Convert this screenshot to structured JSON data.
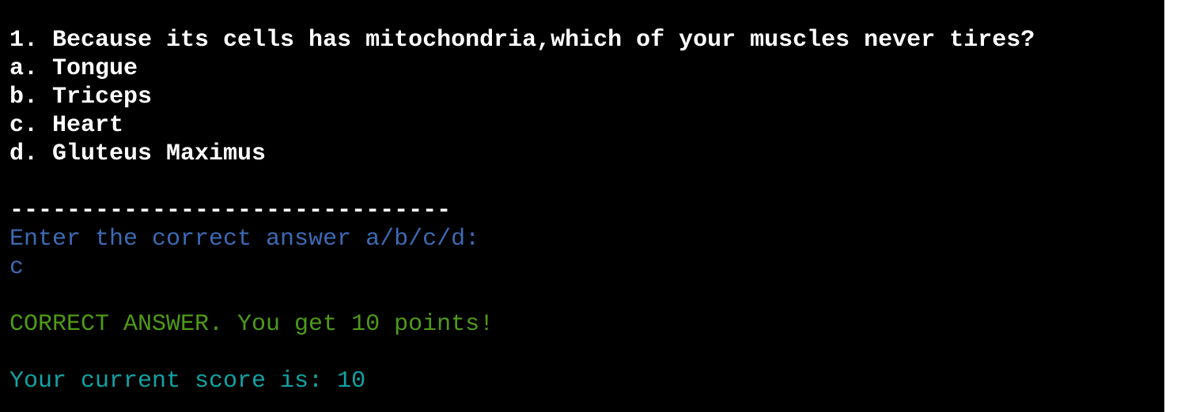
{
  "terminal": {
    "question": "1. Because its cells has mitochondria,which of your muscles never tires?",
    "options": [
      "a. Tongue",
      "b. Triceps",
      "c. Heart",
      "d. Gluteus Maximus"
    ],
    "separator": "-------------------------------",
    "prompt": "Enter the correct answer a/b/c/d:",
    "user_input": "c",
    "result": "CORRECT ANSWER. You get 10 points!",
    "score_line": "Your current score is: 10"
  },
  "colors": {
    "background": "#000000",
    "text": "#ffffff",
    "prompt": "#3d6ab5",
    "correct": "#4f9a17",
    "score": "#12a3a5"
  }
}
